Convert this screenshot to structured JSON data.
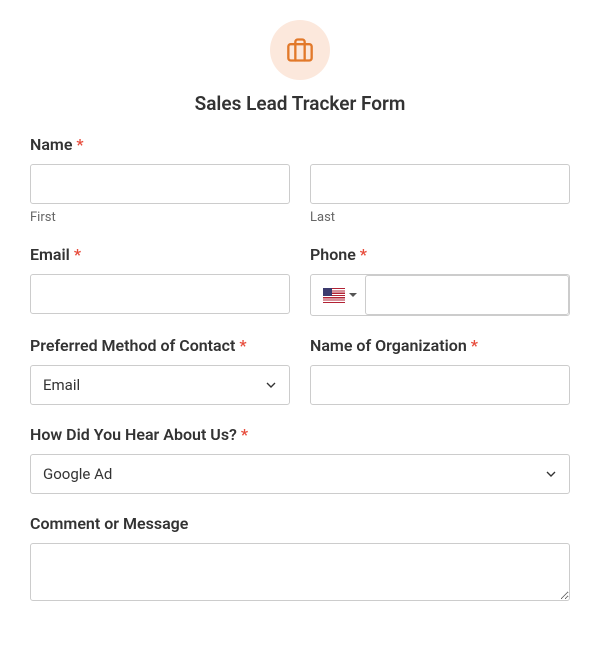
{
  "header": {
    "title": "Sales Lead Tracker Form"
  },
  "fields": {
    "name": {
      "label": "Name",
      "first_sublabel": "First",
      "last_sublabel": "Last"
    },
    "email": {
      "label": "Email"
    },
    "phone": {
      "label": "Phone"
    },
    "contact_method": {
      "label": "Preferred Method of Contact",
      "selected": "Email"
    },
    "organization": {
      "label": "Name of Organization"
    },
    "hear_about": {
      "label": "How Did You Hear About Us?",
      "selected": "Google Ad"
    },
    "comment": {
      "label": "Comment or Message"
    }
  }
}
